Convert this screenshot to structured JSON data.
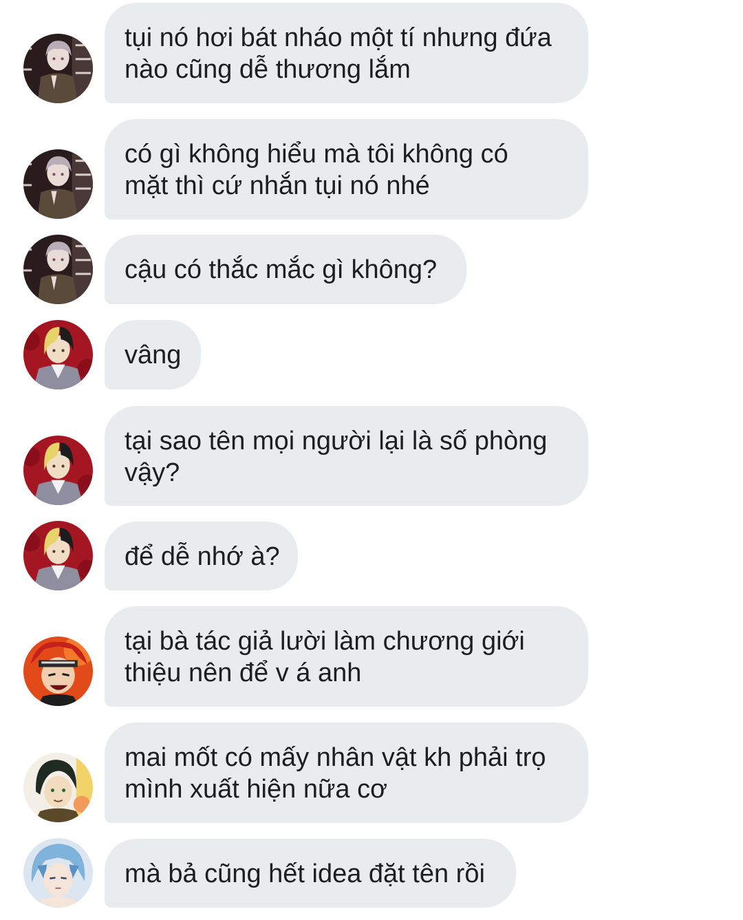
{
  "messages": [
    {
      "sender_avatar": "gray-haired-character-avatar",
      "lines": [
        "tụi nó hơi bát nháo một tí nhưng đứa",
        "nào cũng dễ thương lắm"
      ]
    },
    {
      "sender_avatar": "gray-haired-character-avatar",
      "lines": [
        "có gì không hiểu mà tôi không có",
        "mặt thì cứ nhắn tụi nó nhé"
      ]
    },
    {
      "sender_avatar": "gray-haired-character-avatar",
      "lines": [
        "cậu có thắc mắc gì không?"
      ]
    },
    {
      "sender_avatar": "blonde-black-haired-character-avatar",
      "lines": [
        "vâng"
      ]
    },
    {
      "sender_avatar": "blonde-black-haired-character-avatar",
      "lines": [
        "tại sao tên mọi người lại là số phòng",
        "vậy?"
      ]
    },
    {
      "sender_avatar": "blonde-black-haired-character-avatar",
      "lines": [
        "để dễ nhớ à?"
      ]
    },
    {
      "sender_avatar": "red-haired-headband-character-avatar",
      "lines": [
        "tại bà tác giả lười làm chương giới",
        "thiệu nên để v á anh"
      ]
    },
    {
      "sender_avatar": "dark-green-haired-character-avatar",
      "lines": [
        "mai mốt có mấy nhân vật kh phải trọ",
        "mình xuất hiện nữa cơ"
      ]
    },
    {
      "sender_avatar": "blue-haired-character-avatar",
      "lines": [
        "mà bả cũng hết idea đặt tên rồi"
      ]
    }
  ],
  "colors": {
    "bubble_background": "#e9ecef",
    "text": "#1c1e21",
    "page_background": "#ffffff"
  }
}
